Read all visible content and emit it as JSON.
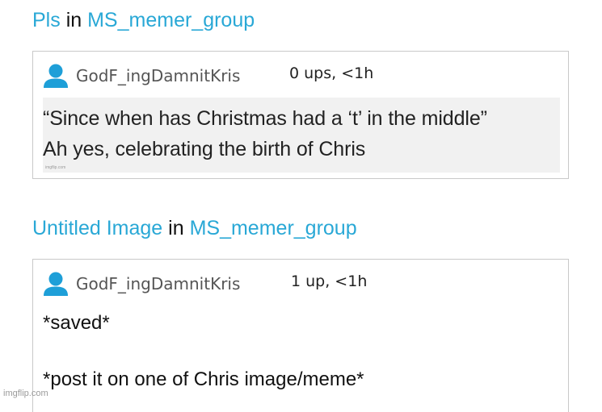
{
  "posts": [
    {
      "title": "Pls",
      "in_word": "in",
      "group": "MS_memer_group",
      "username": "GodF_ingDamnitKris",
      "meta": "0 ups, <1h",
      "lines": [
        "“Since when has Christmas had a ‘t’ in the middle”",
        "Ah yes, celebrating the birth of Chris"
      ],
      "image_watermark": "imgflip.com"
    },
    {
      "title": "Untitled Image",
      "in_word": "in",
      "group": "MS_memer_group",
      "username": "GodF_ingDamnitKris",
      "meta": "1 up, <1h",
      "lines": [
        "*saved*",
        "*post it on one of Chris image/meme*"
      ]
    }
  ],
  "watermark": "imgflip.com",
  "colors": {
    "link": "#29a8d6",
    "avatar": "#1e9fd8"
  },
  "icons": {
    "avatar": "user-icon"
  }
}
